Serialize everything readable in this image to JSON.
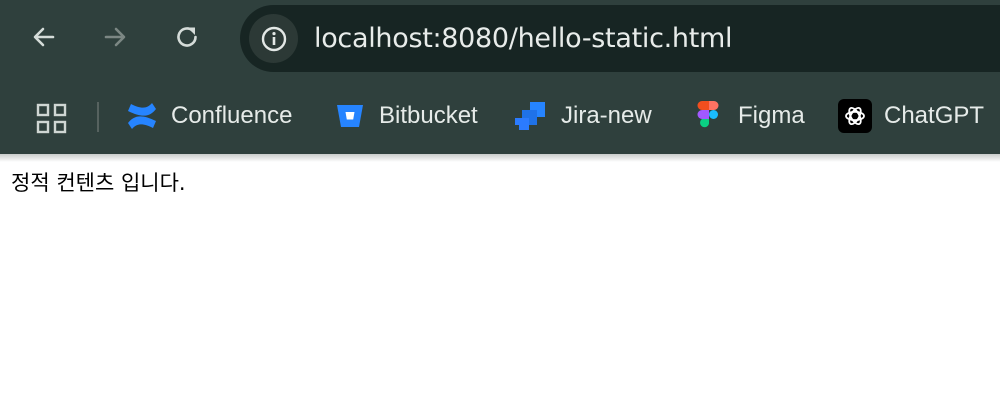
{
  "browser": {
    "url": "localhost:8080/hello-static.html",
    "nav": {
      "back_icon": "arrow-left-icon",
      "forward_icon": "arrow-right-icon",
      "reload_icon": "reload-icon",
      "site_info_icon": "info-icon"
    },
    "bookmarks": [
      {
        "label": "Confluence",
        "icon": "confluence-icon",
        "color": "#2684ff"
      },
      {
        "label": "Bitbucket",
        "icon": "bitbucket-icon",
        "color": "#2684ff"
      },
      {
        "label": "Jira-new",
        "icon": "jira-icon",
        "color": "#2684ff"
      },
      {
        "label": "Figma",
        "icon": "figma-icon",
        "color": "#f24e1e"
      },
      {
        "label": "ChatGPT",
        "icon": "chatgpt-icon",
        "color": "#000000"
      }
    ],
    "colors": {
      "frame": "#2f403d",
      "omnibox": "#172523",
      "text": "#e6ebe9"
    }
  },
  "page": {
    "text": "정적 컨텐츠 입니다."
  }
}
